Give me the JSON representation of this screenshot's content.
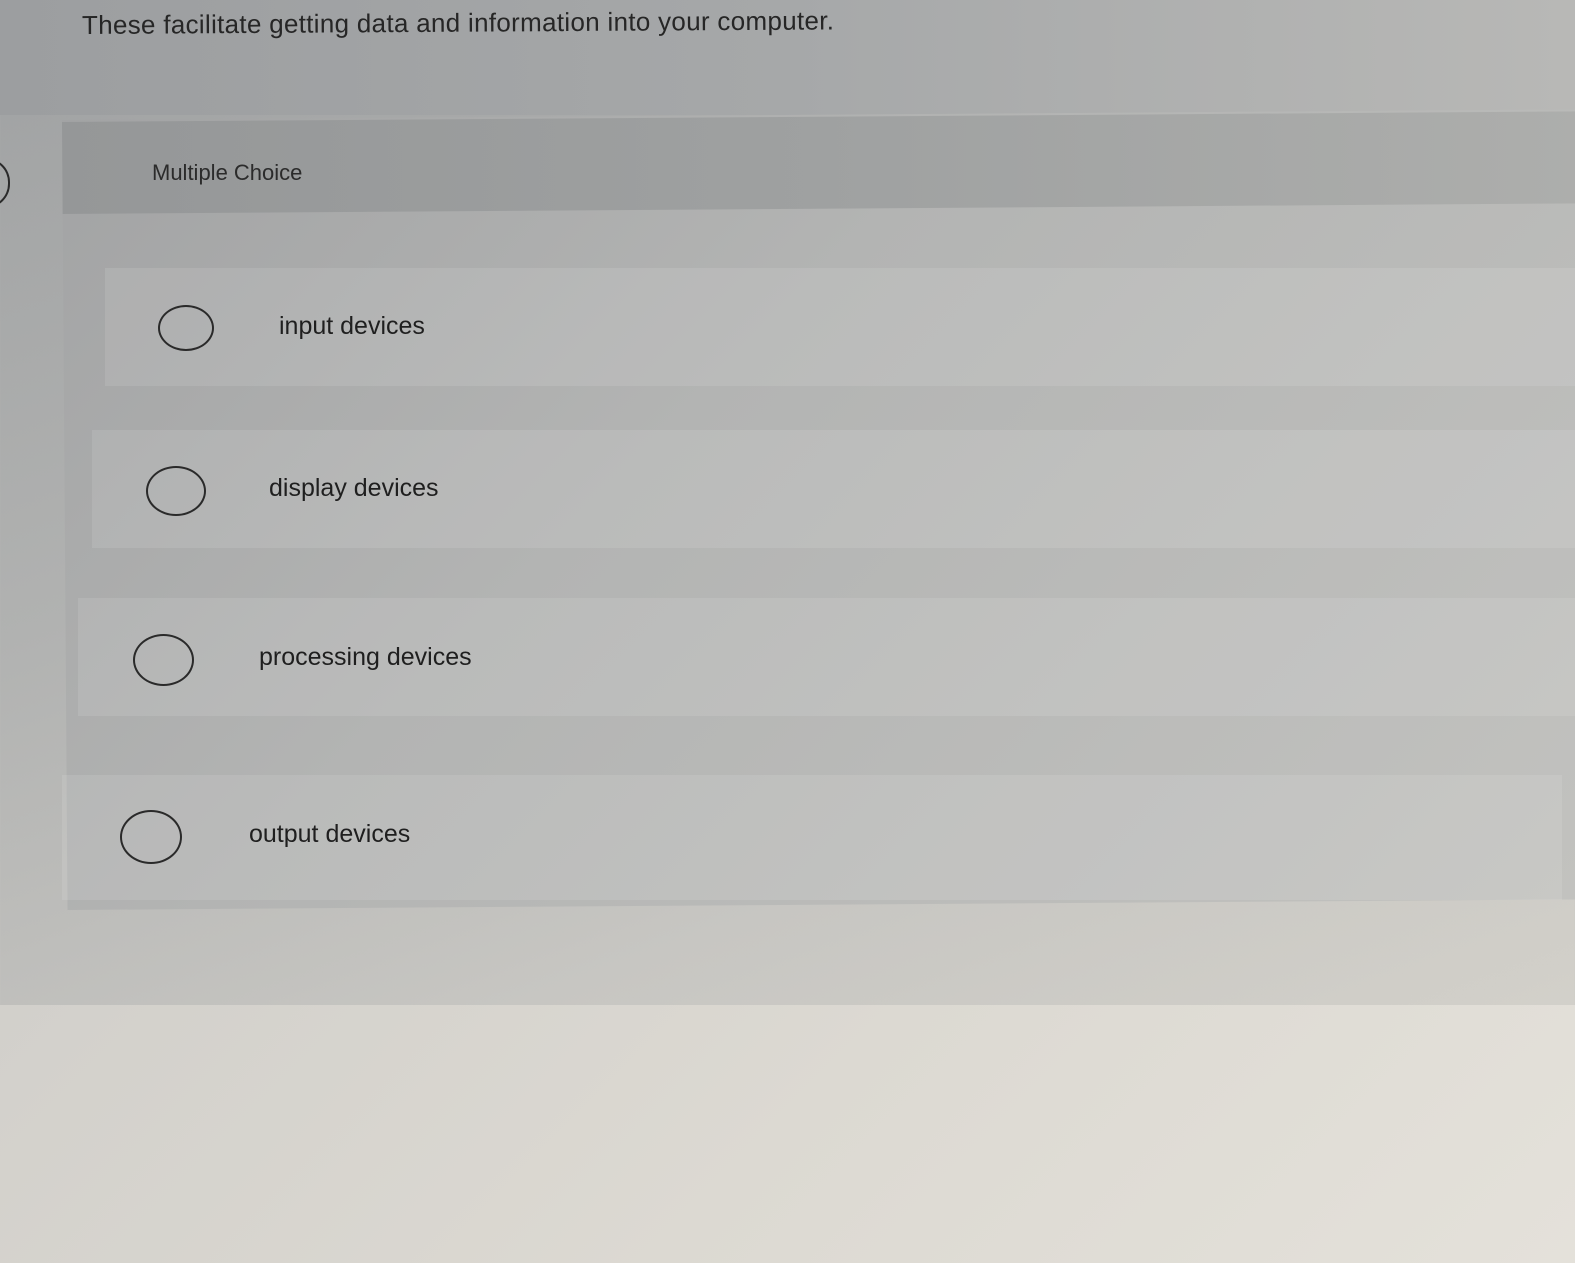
{
  "question": {
    "text": "These facilitate getting data and information into your computer."
  },
  "multiple_choice": {
    "label": "Multiple Choice",
    "options": [
      {
        "label": "input devices"
      },
      {
        "label": "display devices"
      },
      {
        "label": "processing devices"
      },
      {
        "label": "output devices"
      }
    ]
  }
}
